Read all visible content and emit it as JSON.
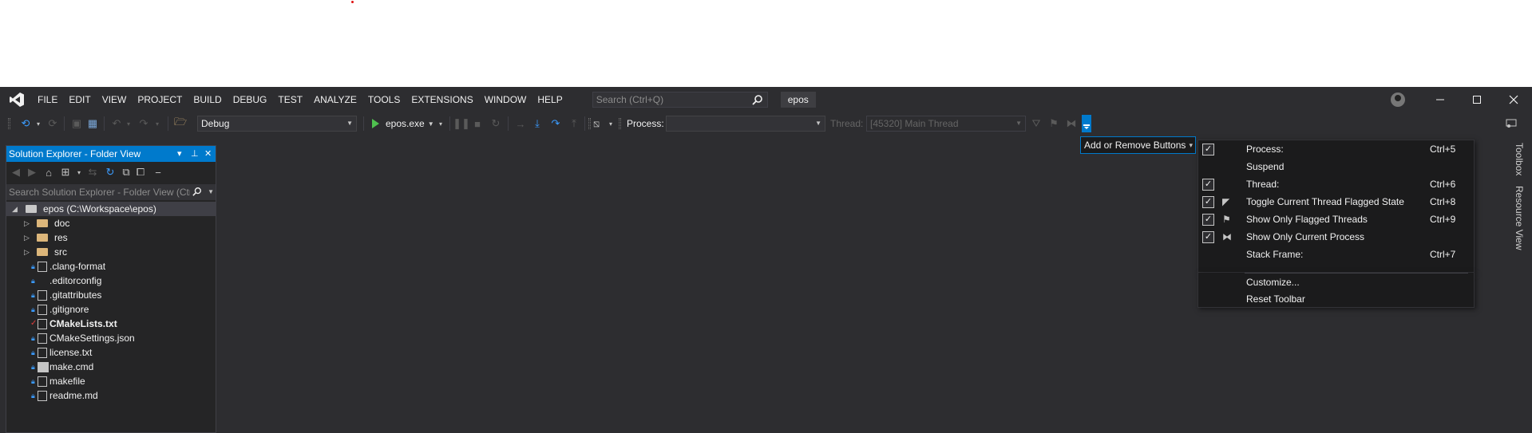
{
  "menu": {
    "items": [
      "FILE",
      "EDIT",
      "VIEW",
      "PROJECT",
      "BUILD",
      "DEBUG",
      "TEST",
      "ANALYZE",
      "TOOLS",
      "EXTENSIONS",
      "WINDOW",
      "HELP"
    ],
    "search_placeholder": "Search (Ctrl+Q)",
    "solution_name": "epos"
  },
  "toolbar": {
    "configuration": "Debug",
    "start_target": "epos.exe",
    "process_label": "Process:",
    "process_value": "",
    "thread_label": "Thread:",
    "thread_value": "[45320] Main Thread"
  },
  "solution_explorer": {
    "title": "Solution Explorer - Folder View",
    "search_placeholder": "Search Solution Explorer - Folder View (Ctr",
    "root": "epos (C:\\Workspace\\epos)",
    "folders": [
      "doc",
      "res",
      "src"
    ],
    "files": [
      {
        "name": ".clang-format",
        "status": "lock",
        "icon": "settings-file-icon",
        "bold": false
      },
      {
        "name": ".editorconfig",
        "status": "lock",
        "icon": "",
        "bold": false
      },
      {
        "name": ".gitattributes",
        "status": "lock",
        "icon": "file-icon",
        "bold": false
      },
      {
        "name": ".gitignore",
        "status": "lock",
        "icon": "file-icon",
        "bold": false
      },
      {
        "name": "CMakeLists.txt",
        "status": "check",
        "icon": "file-icon",
        "bold": true
      },
      {
        "name": "CMakeSettings.json",
        "status": "lock",
        "icon": "json-settings-icon",
        "bold": false
      },
      {
        "name": "license.txt",
        "status": "lock",
        "icon": "file-icon",
        "bold": false
      },
      {
        "name": "make.cmd",
        "status": "lock",
        "icon": "cmd-icon",
        "bold": false
      },
      {
        "name": "makefile",
        "status": "lock",
        "icon": "file-icon",
        "bold": false
      },
      {
        "name": "readme.md",
        "status": "lock",
        "icon": "file-icon",
        "bold": false
      }
    ]
  },
  "side_tabs": [
    "Toolbox",
    "Resource View"
  ],
  "popup": {
    "header": "Add or Remove Buttons",
    "items": [
      {
        "label": "Process:",
        "shortcut": "Ctrl+5",
        "checked": true,
        "icon": ""
      },
      {
        "label": "Suspend",
        "shortcut": "",
        "checked": false,
        "icon": ""
      },
      {
        "label": "Thread:",
        "shortcut": "Ctrl+6",
        "checked": true,
        "icon": ""
      },
      {
        "label": "Toggle Current Thread Flagged State",
        "shortcut": "Ctrl+8",
        "checked": true,
        "icon": "flag-icon"
      },
      {
        "label": "Show Only Flagged Threads",
        "shortcut": "Ctrl+9",
        "checked": true,
        "icon": "flagged-threads-icon"
      },
      {
        "label": "Show Only Current Process",
        "shortcut": "",
        "checked": true,
        "icon": "current-process-icon"
      },
      {
        "label": "Stack Frame:",
        "shortcut": "Ctrl+7",
        "checked": false,
        "icon": ""
      }
    ],
    "customize": "Customize...",
    "reset": "Reset Toolbar"
  },
  "colors": {
    "accent": "#007acc",
    "background": "#2d2d30",
    "panel": "#252526",
    "folder": "#dcb67a"
  }
}
